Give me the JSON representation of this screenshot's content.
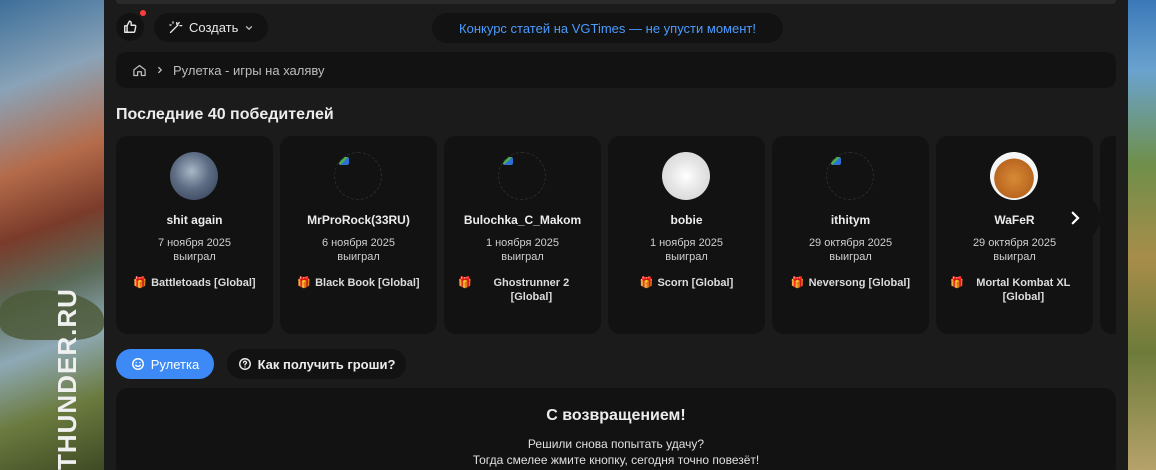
{
  "header": {
    "create_label": "Создать",
    "promo_text": "Конкурс статей на VGTimes — не упусти момент!",
    "promo_icon_left": "",
    "promo_icon_right": ""
  },
  "breadcrumb": {
    "current": "Рулетка - игры на халяву"
  },
  "winners": {
    "title": "Последние 40 победителей",
    "items": [
      {
        "name": "shit again",
        "date": "7 ноября 2025",
        "status": "выиграл",
        "prize": "Battletoads [Global]",
        "avatar": "blue-face"
      },
      {
        "name": "MrProRock(33RU)",
        "date": "6 ноября 2025",
        "status": "выиграл",
        "prize": "Black Book [Global]",
        "avatar": "broken-image"
      },
      {
        "name": "Bulochka_C_Makom",
        "date": "1 ноября 2025",
        "status": "выиграл",
        "prize": "Ghostrunner 2 [Global]",
        "avatar": "broken-image"
      },
      {
        "name": "bobie",
        "date": "1 ноября 2025",
        "status": "выиграл",
        "prize": "Scorn [Global]",
        "avatar": "sketch-face"
      },
      {
        "name": "ithitym",
        "date": "29 октября 2025",
        "status": "выиграл",
        "prize": "Neversong [Global]",
        "avatar": "broken-image"
      },
      {
        "name": "WaFeR",
        "date": "29 октября 2025",
        "status": "выиграл",
        "prize": "Mortal Kombat XL [Global]",
        "avatar": "waffles"
      }
    ]
  },
  "tabs": {
    "roulette_label": "Рулетка",
    "howto_label": "Как получить гроши?"
  },
  "welcome": {
    "title": "С возвращением!",
    "line1": "Решили снова попытать удачу?",
    "line2": "Тогда смелее жмите кнопку, сегодня точно повезёт!"
  },
  "side_banner": {
    "brand": "THUNDER.RU"
  },
  "colors": {
    "accent": "#3d8af7",
    "promo_link": "#4a9cff",
    "notification": "#ff3b3b",
    "card_bg": "#121212",
    "page_bg": "#1b1b1b"
  }
}
